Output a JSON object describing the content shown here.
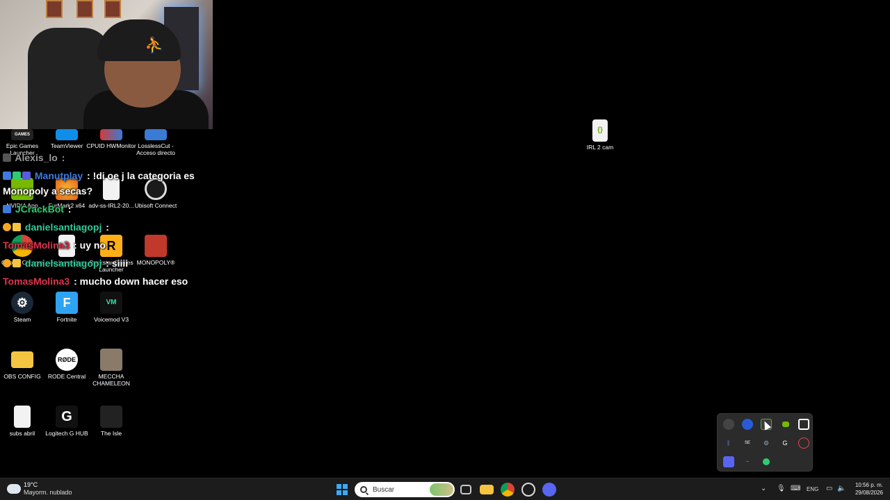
{
  "desktop_icons": [
    {
      "label": "Epic Games Launcher",
      "icon": "epic-games-icon",
      "color": "#222222"
    },
    {
      "label": "TeamViewer",
      "icon": "teamviewer-icon",
      "color": "#0e8ee9"
    },
    {
      "label": "CPUID HWMonitor",
      "icon": "cpuid-icon",
      "color": "#d33b3b"
    },
    {
      "label": "LosslessCut - Acceso directo",
      "icon": "losslesscut-icon",
      "color": "#3a7bd5"
    },
    {
      "label": "NVIDIA App",
      "icon": "nvidia-icon",
      "color": "#76b900"
    },
    {
      "label": "FurMark2 x64",
      "icon": "furmark-icon",
      "color": "#e2611b"
    },
    {
      "label": "adv-ss-IRL2-20...",
      "icon": "document-icon",
      "color": "#f2f2f2"
    },
    {
      "label": "Ubisoft Connect",
      "icon": "ubisoft-icon",
      "color": "#1a1a1a"
    },
    {
      "label": "Google Chrome",
      "icon": "chrome-icon",
      "color": "#db4437"
    },
    {
      "label": "en las malas",
      "icon": "document-icon",
      "color": "#f2f2f2"
    },
    {
      "label": "Rockstar Games Launcher",
      "icon": "rockstar-icon",
      "color": "#fcaf17"
    },
    {
      "label": "MONOPOLY®",
      "icon": "monopoly-icon",
      "color": "#c0392b"
    },
    {
      "label": "Steam",
      "icon": "steam-icon",
      "color": "#1b2838"
    },
    {
      "label": "Fortnite",
      "icon": "fortnite-icon",
      "color": "#2ea3f2"
    },
    {
      "label": "Voicemod V3",
      "icon": "voicemod-icon",
      "color": "#111111"
    },
    {
      "label": "OBS CONFIG",
      "icon": "folder-icon",
      "color": "#f5c542"
    },
    {
      "label": "RODE Central",
      "icon": "rode-icon",
      "color": "#ffffff"
    },
    {
      "label": "MECCHA CHAMELEON",
      "icon": "game-icon",
      "color": "#8a7a6a"
    },
    {
      "label": "subs abril",
      "icon": "document-icon",
      "color": "#f2f2f2"
    },
    {
      "label": "Logitech G HUB",
      "icon": "logitech-icon",
      "color": "#111111"
    },
    {
      "label": "The Isle",
      "icon": "the-isle-icon",
      "color": "#222222"
    },
    {
      "label": "IRL 2 cam",
      "icon": "json-file-icon",
      "color": "#f2f2f2"
    }
  ],
  "chat": [
    {
      "user": "Alexis_lo",
      "user_color": "#9a9a9a",
      "text": " :"
    },
    {
      "user": "Manutplay",
      "user_color": "#3d7be0",
      "text": " : !di oe j la categoria es"
    },
    {
      "user": "",
      "user_color": "#ffffff",
      "text": "Monopoly a secas?"
    },
    {
      "user": "JCrackBot",
      "user_color": "#2ecc71",
      "text": " :"
    },
    {
      "user": "danielsantiagopj",
      "user_color": "#2ecc9a",
      "text": " :"
    },
    {
      "user": "TomasMolina3",
      "user_color": "#e0334d",
      "text": " : uy no"
    },
    {
      "user": "danielsantiagopj",
      "user_color": "#2ecc9a",
      "text": " : siiii"
    },
    {
      "user": "TomasMolina3",
      "user_color": "#e0334d",
      "text": " : mucho down hacer eso"
    }
  ],
  "taskbar": {
    "weather_temp": "19°C",
    "weather_desc": "Mayorm. nublado",
    "search_placeholder": "Buscar",
    "language": "ENG",
    "time": "10:56 p. m.",
    "date": "29/08/2026",
    "chevron": "⌄"
  }
}
